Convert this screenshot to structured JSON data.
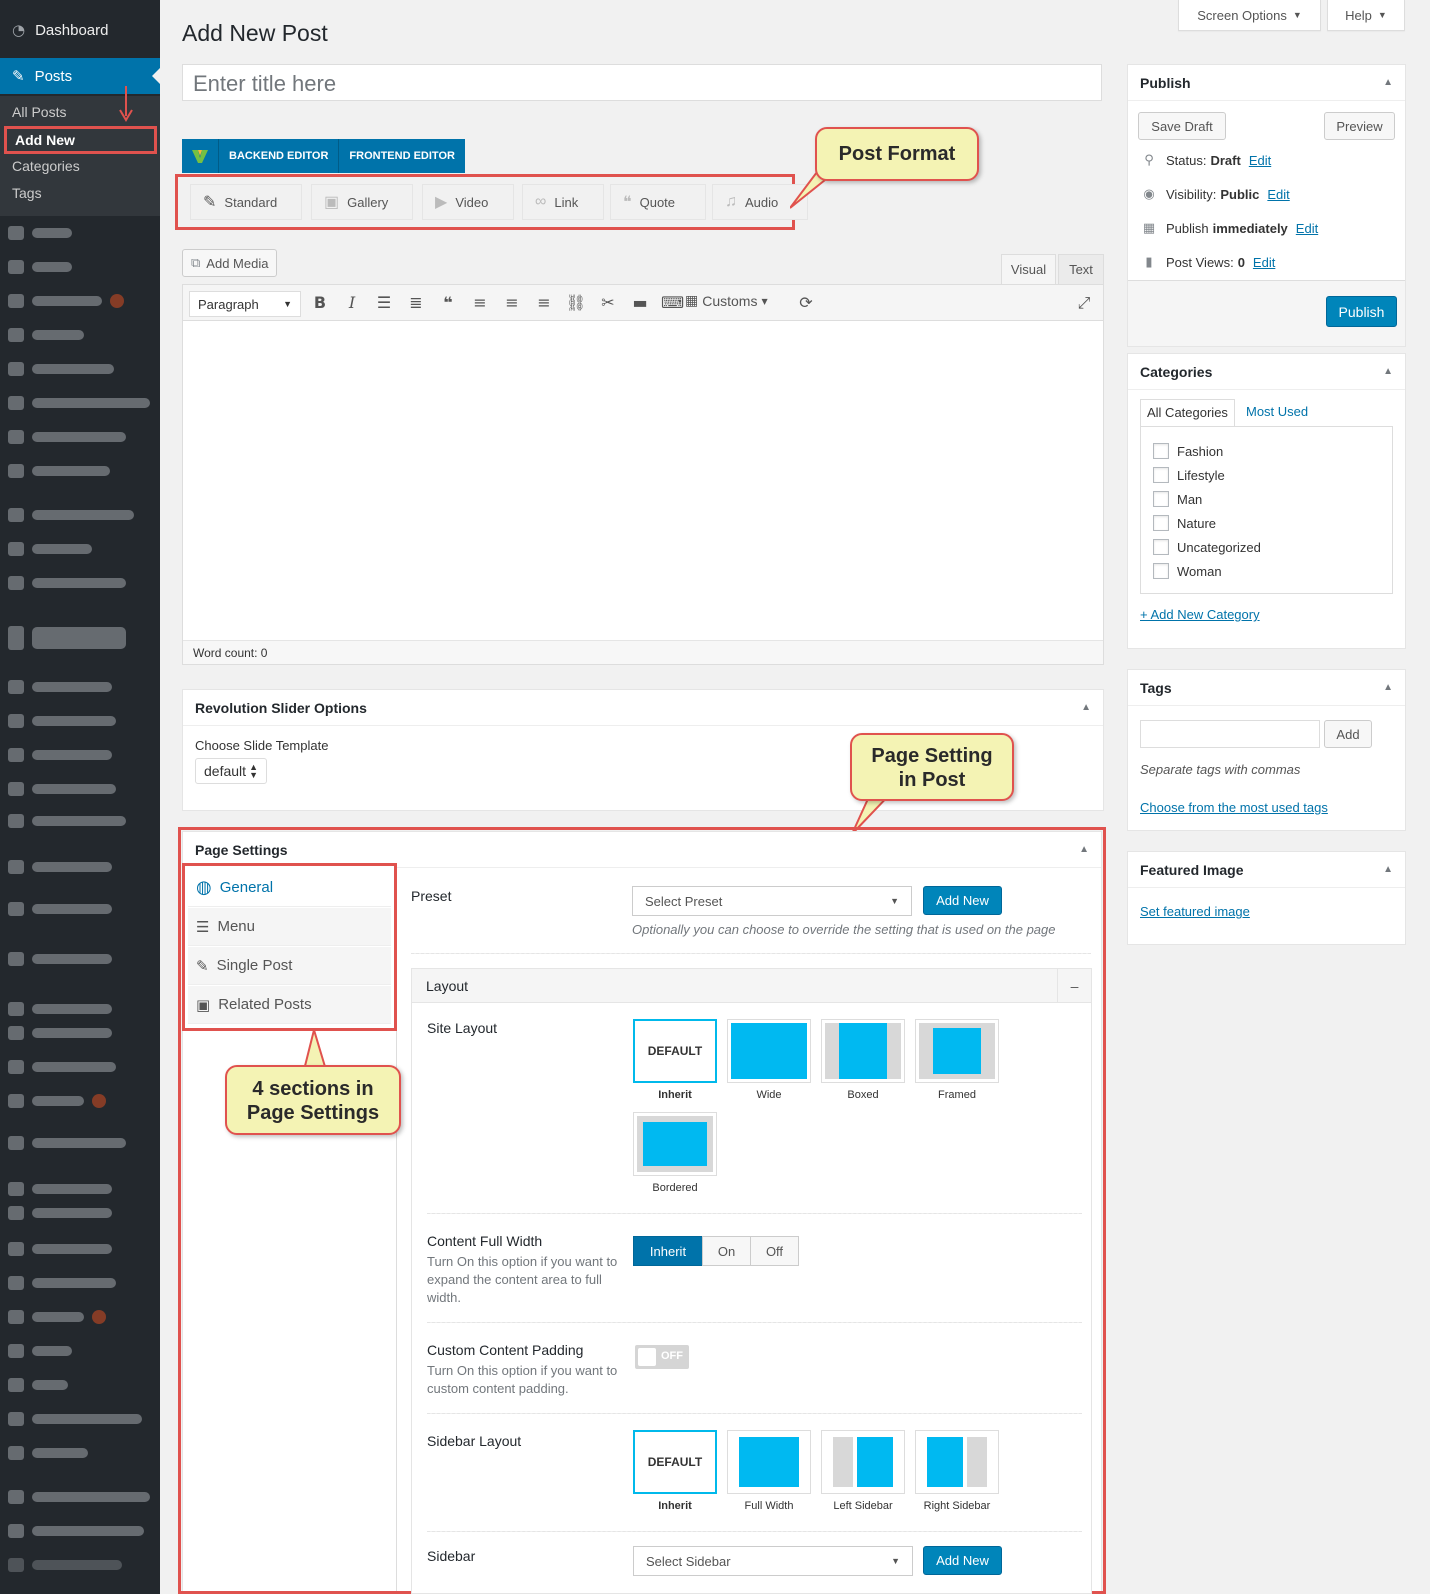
{
  "sidebar": {
    "dashboard": "Dashboard",
    "posts": "Posts",
    "submenu": [
      "All Posts",
      "Add New",
      "Categories",
      "Tags"
    ]
  },
  "top": {
    "screen_options": "Screen Options",
    "help": "Help"
  },
  "page_title": "Add New Post",
  "title_placeholder": "Enter title here",
  "vc": {
    "backend": "BACKEND EDITOR",
    "frontend": "FRONTEND EDITOR"
  },
  "post_formats": [
    "Standard",
    "Gallery",
    "Video",
    "Link",
    "Quote",
    "Audio"
  ],
  "callouts": {
    "post_format": "Post Format",
    "page_setting_1": "Page Setting",
    "page_setting_2": "in Post",
    "sections_1": "4 sections in",
    "sections_2": "Page Settings"
  },
  "editor": {
    "add_media": "Add Media",
    "tab_visual": "Visual",
    "tab_text": "Text",
    "format_select": "Paragraph",
    "customs": "Customs",
    "word_count": "Word count: 0"
  },
  "revslider": {
    "title": "Revolution Slider Options",
    "label": "Choose Slide Template",
    "value": "default"
  },
  "page_settings": {
    "title": "Page Settings",
    "tabs": [
      "General",
      "Menu",
      "Single Post",
      "Related Posts"
    ],
    "preset_label": "Preset",
    "preset_placeholder": "Select Preset",
    "add_new": "Add New",
    "preset_desc": "Optionally you can choose to override the setting that is used on the page",
    "layout_heading": "Layout",
    "collapse": "–",
    "site_layout_label": "Site Layout",
    "site_layouts": [
      "Inherit",
      "Wide",
      "Boxed",
      "Framed",
      "Bordered"
    ],
    "default_text": "DEFAULT",
    "content_full_width_label": "Content Full Width",
    "content_full_width_desc": "Turn On this option if you want to expand the content area to full width.",
    "cfw_options": [
      "Inherit",
      "On",
      "Off"
    ],
    "cfw_selected": "Inherit",
    "custom_padding_label": "Custom Content Padding",
    "custom_padding_desc": "Turn On this option if you want to custom content padding.",
    "custom_padding_state": "OFF",
    "sidebar_layout_label": "Sidebar Layout",
    "sidebar_layouts": [
      "Inherit",
      "Full Width",
      "Left Sidebar",
      "Right Sidebar"
    ],
    "sidebar_label": "Sidebar",
    "sidebar_placeholder": "Select Sidebar",
    "sidebar_add_new": "Add New"
  },
  "publish": {
    "title": "Publish",
    "save_draft": "Save Draft",
    "preview": "Preview",
    "status_label": "Status:",
    "status_value": "Draft",
    "visibility_label": "Visibility:",
    "visibility_value": "Public",
    "publish_label": "Publish",
    "publish_value": "immediately",
    "views_label": "Post Views:",
    "views_value": "0",
    "edit": "Edit",
    "publish_btn": "Publish"
  },
  "categories": {
    "title": "Categories",
    "tab_all": "All Categories",
    "tab_most": "Most Used",
    "items": [
      "Fashion",
      "Lifestyle",
      "Man",
      "Nature",
      "Uncategorized",
      "Woman"
    ],
    "add_new": "+ Add New Category"
  },
  "tags": {
    "title": "Tags",
    "add": "Add",
    "hint": "Separate tags with commas",
    "choose": "Choose from the most used tags"
  },
  "featured": {
    "title": "Featured Image",
    "set": "Set featured image"
  },
  "colors": {
    "accent": "#0073aa",
    "annotation": "#e0524e",
    "callout_bg": "#f4f3b4",
    "preview_blue": "#00b9f1"
  }
}
